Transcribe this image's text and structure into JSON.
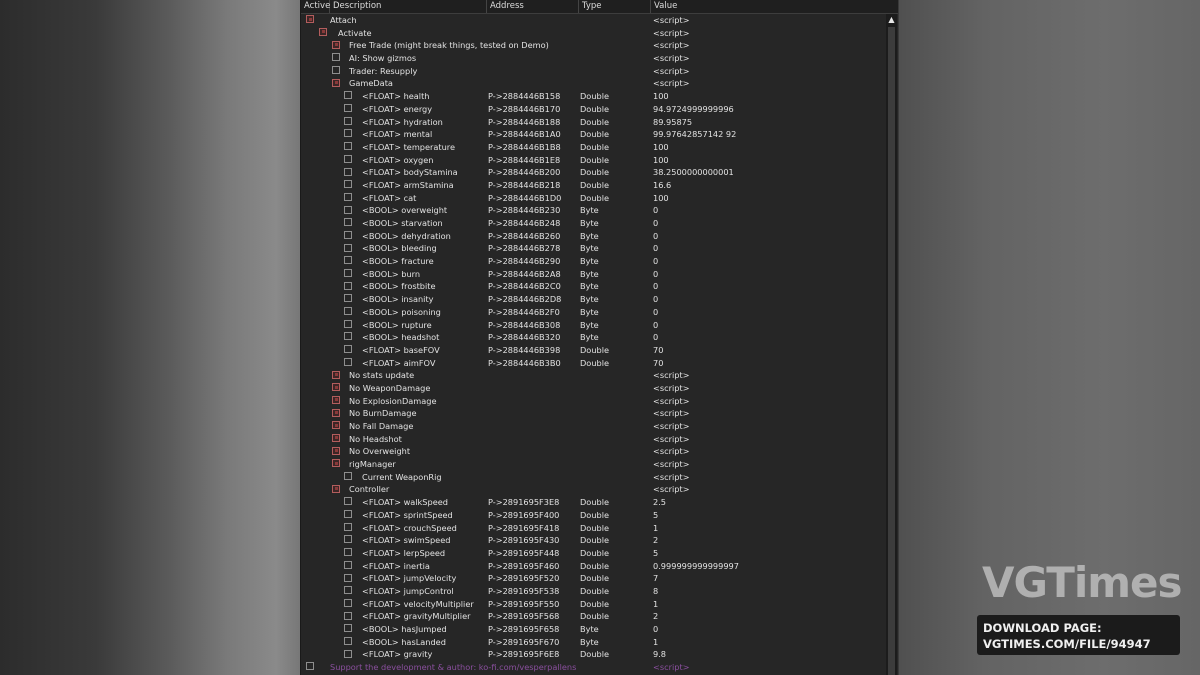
{
  "columns": [
    "Active",
    "Description",
    "Address",
    "Type",
    "Value"
  ],
  "rows": [
    {
      "level": 0,
      "cb": "red",
      "desc": "Attach",
      "addr": "",
      "type": "",
      "val": "<script>"
    },
    {
      "level": 1,
      "cb": "red",
      "desc": "Activate",
      "addr": "",
      "type": "",
      "val": "<script>"
    },
    {
      "level": 2,
      "cb": "red",
      "desc": "Free Trade (might break things, tested on Demo)",
      "addr": "",
      "type": "",
      "val": "<script>"
    },
    {
      "level": 2,
      "cb": "grey",
      "desc": "AI: Show gizmos",
      "addr": "",
      "type": "",
      "val": "<script>"
    },
    {
      "level": 2,
      "cb": "grey",
      "desc": "Trader: Resupply",
      "addr": "",
      "type": "",
      "val": "<script>"
    },
    {
      "level": 2,
      "cb": "red",
      "desc": "GameData",
      "addr": "",
      "type": "",
      "val": "<script>"
    },
    {
      "level": 3,
      "cb": "grey",
      "desc": "<FLOAT> health",
      "addr": "P->2884446B158",
      "type": "Double",
      "val": "100"
    },
    {
      "level": 3,
      "cb": "grey",
      "desc": "<FLOAT> energy",
      "addr": "P->2884446B170",
      "type": "Double",
      "val": "94.9724999999996"
    },
    {
      "level": 3,
      "cb": "grey",
      "desc": "<FLOAT> hydration",
      "addr": "P->2884446B188",
      "type": "Double",
      "val": "89.95875"
    },
    {
      "level": 3,
      "cb": "grey",
      "desc": "<FLOAT> mental",
      "addr": "P->2884446B1A0",
      "type": "Double",
      "val": "99.97642857142 92"
    },
    {
      "level": 3,
      "cb": "grey",
      "desc": "<FLOAT> temperature",
      "addr": "P->2884446B1B8",
      "type": "Double",
      "val": "100"
    },
    {
      "level": 3,
      "cb": "grey",
      "desc": "<FLOAT> oxygen",
      "addr": "P->2884446B1E8",
      "type": "Double",
      "val": "100"
    },
    {
      "level": 3,
      "cb": "grey",
      "desc": "<FLOAT> bodyStamina",
      "addr": "P->2884446B200",
      "type": "Double",
      "val": "38.2500000000001"
    },
    {
      "level": 3,
      "cb": "grey",
      "desc": "<FLOAT> armStamina",
      "addr": "P->2884446B218",
      "type": "Double",
      "val": "16.6"
    },
    {
      "level": 3,
      "cb": "grey",
      "desc": "<FLOAT> cat",
      "addr": "P->2884446B1D0",
      "type": "Double",
      "val": "100"
    },
    {
      "level": 3,
      "cb": "grey",
      "desc": "<BOOL> overweight",
      "addr": "P->2884446B230",
      "type": "Byte",
      "val": "0"
    },
    {
      "level": 3,
      "cb": "grey",
      "desc": "<BOOL> starvation",
      "addr": "P->2884446B248",
      "type": "Byte",
      "val": "0"
    },
    {
      "level": 3,
      "cb": "grey",
      "desc": "<BOOL> dehydration",
      "addr": "P->2884446B260",
      "type": "Byte",
      "val": "0"
    },
    {
      "level": 3,
      "cb": "grey",
      "desc": "<BOOL> bleeding",
      "addr": "P->2884446B278",
      "type": "Byte",
      "val": "0"
    },
    {
      "level": 3,
      "cb": "grey",
      "desc": "<BOOL> fracture",
      "addr": "P->2884446B290",
      "type": "Byte",
      "val": "0"
    },
    {
      "level": 3,
      "cb": "grey",
      "desc": "<BOOL> burn",
      "addr": "P->2884446B2A8",
      "type": "Byte",
      "val": "0"
    },
    {
      "level": 3,
      "cb": "grey",
      "desc": "<BOOL> frostbite",
      "addr": "P->2884446B2C0",
      "type": "Byte",
      "val": "0"
    },
    {
      "level": 3,
      "cb": "grey",
      "desc": "<BOOL> insanity",
      "addr": "P->2884446B2D8",
      "type": "Byte",
      "val": "0"
    },
    {
      "level": 3,
      "cb": "grey",
      "desc": "<BOOL> poisoning",
      "addr": "P->2884446B2F0",
      "type": "Byte",
      "val": "0"
    },
    {
      "level": 3,
      "cb": "grey",
      "desc": "<BOOL> rupture",
      "addr": "P->2884446B308",
      "type": "Byte",
      "val": "0"
    },
    {
      "level": 3,
      "cb": "grey",
      "desc": "<BOOL> headshot",
      "addr": "P->2884446B320",
      "type": "Byte",
      "val": "0"
    },
    {
      "level": 3,
      "cb": "grey",
      "desc": "<FLOAT> baseFOV",
      "addr": "P->2884446B398",
      "type": "Double",
      "val": "70"
    },
    {
      "level": 3,
      "cb": "grey",
      "desc": "<FLOAT> aimFOV",
      "addr": "P->2884446B3B0",
      "type": "Double",
      "val": "70"
    },
    {
      "level": 2,
      "cb": "red",
      "desc": "No stats update",
      "addr": "",
      "type": "",
      "val": "<script>"
    },
    {
      "level": 2,
      "cb": "red",
      "desc": "No WeaponDamage",
      "addr": "",
      "type": "",
      "val": "<script>"
    },
    {
      "level": 2,
      "cb": "red",
      "desc": "No ExplosionDamage",
      "addr": "",
      "type": "",
      "val": "<script>"
    },
    {
      "level": 2,
      "cb": "red",
      "desc": "No BurnDamage",
      "addr": "",
      "type": "",
      "val": "<script>"
    },
    {
      "level": 2,
      "cb": "red",
      "desc": "No Fall Damage",
      "addr": "",
      "type": "",
      "val": "<script>"
    },
    {
      "level": 2,
      "cb": "red",
      "desc": "No Headshot",
      "addr": "",
      "type": "",
      "val": "<script>"
    },
    {
      "level": 2,
      "cb": "red",
      "desc": "No Overweight",
      "addr": "",
      "type": "",
      "val": "<script>"
    },
    {
      "level": 2,
      "cb": "red",
      "desc": "rigManager",
      "addr": "",
      "type": "",
      "val": "<script>"
    },
    {
      "level": 3,
      "cb": "grey",
      "desc": "Current WeaponRig",
      "addr": "",
      "type": "",
      "val": "<script>"
    },
    {
      "level": 2,
      "cb": "red",
      "desc": "Controller",
      "addr": "",
      "type": "",
      "val": "<script>"
    },
    {
      "level": 3,
      "cb": "grey",
      "desc": "<FLOAT> walkSpeed",
      "addr": "P->2891695F3E8",
      "type": "Double",
      "val": "2.5"
    },
    {
      "level": 3,
      "cb": "grey",
      "desc": "<FLOAT> sprintSpeed",
      "addr": "P->2891695F400",
      "type": "Double",
      "val": "5"
    },
    {
      "level": 3,
      "cb": "grey",
      "desc": "<FLOAT> crouchSpeed",
      "addr": "P->2891695F418",
      "type": "Double",
      "val": "1"
    },
    {
      "level": 3,
      "cb": "grey",
      "desc": "<FLOAT> swimSpeed",
      "addr": "P->2891695F430",
      "type": "Double",
      "val": "2"
    },
    {
      "level": 3,
      "cb": "grey",
      "desc": "<FLOAT> lerpSpeed",
      "addr": "P->2891695F448",
      "type": "Double",
      "val": "5"
    },
    {
      "level": 3,
      "cb": "grey",
      "desc": "<FLOAT> inertia",
      "addr": "P->2891695F460",
      "type": "Double",
      "val": "0.999999999999997"
    },
    {
      "level": 3,
      "cb": "grey",
      "desc": "<FLOAT> jumpVelocity",
      "addr": "P->2891695F520",
      "type": "Double",
      "val": "7"
    },
    {
      "level": 3,
      "cb": "grey",
      "desc": "<FLOAT> jumpControl",
      "addr": "P->2891695F538",
      "type": "Double",
      "val": "8"
    },
    {
      "level": 3,
      "cb": "grey",
      "desc": "<FLOAT> velocityMultiplier",
      "addr": "P->2891695F550",
      "type": "Double",
      "val": "1"
    },
    {
      "level": 3,
      "cb": "grey",
      "desc": "<FLOAT> gravityMultiplier",
      "addr": "P->2891695F568",
      "type": "Double",
      "val": "2"
    },
    {
      "level": 3,
      "cb": "grey",
      "desc": "<BOOL> hasJumped",
      "addr": "P->2891695F658",
      "type": "Byte",
      "val": "0"
    },
    {
      "level": 3,
      "cb": "grey",
      "desc": "<BOOL> hasLanded",
      "addr": "P->2891695F670",
      "type": "Byte",
      "val": "1"
    },
    {
      "level": 3,
      "cb": "grey",
      "desc": "<FLOAT> gravity",
      "addr": "P->2891695F6E8",
      "type": "Double",
      "val": "9.8"
    },
    {
      "level": 0,
      "cb": "grey",
      "desc": "Support the development & author: ko-fi.com/vesperpallens",
      "addr": "",
      "type": "",
      "val": "<script>",
      "style": "support"
    }
  ],
  "watermark": "VGTimes",
  "download": {
    "line1": "DOWNLOAD PAGE:",
    "line2": "VGTIMES.COM/FILE/94947"
  },
  "colors": {
    "panel": "#262626",
    "text": "#e2e2e2",
    "checkbox_active": "#b35d5d",
    "support_text": "#8a4f9e"
  },
  "icons": {
    "scroll_up": "▲"
  }
}
